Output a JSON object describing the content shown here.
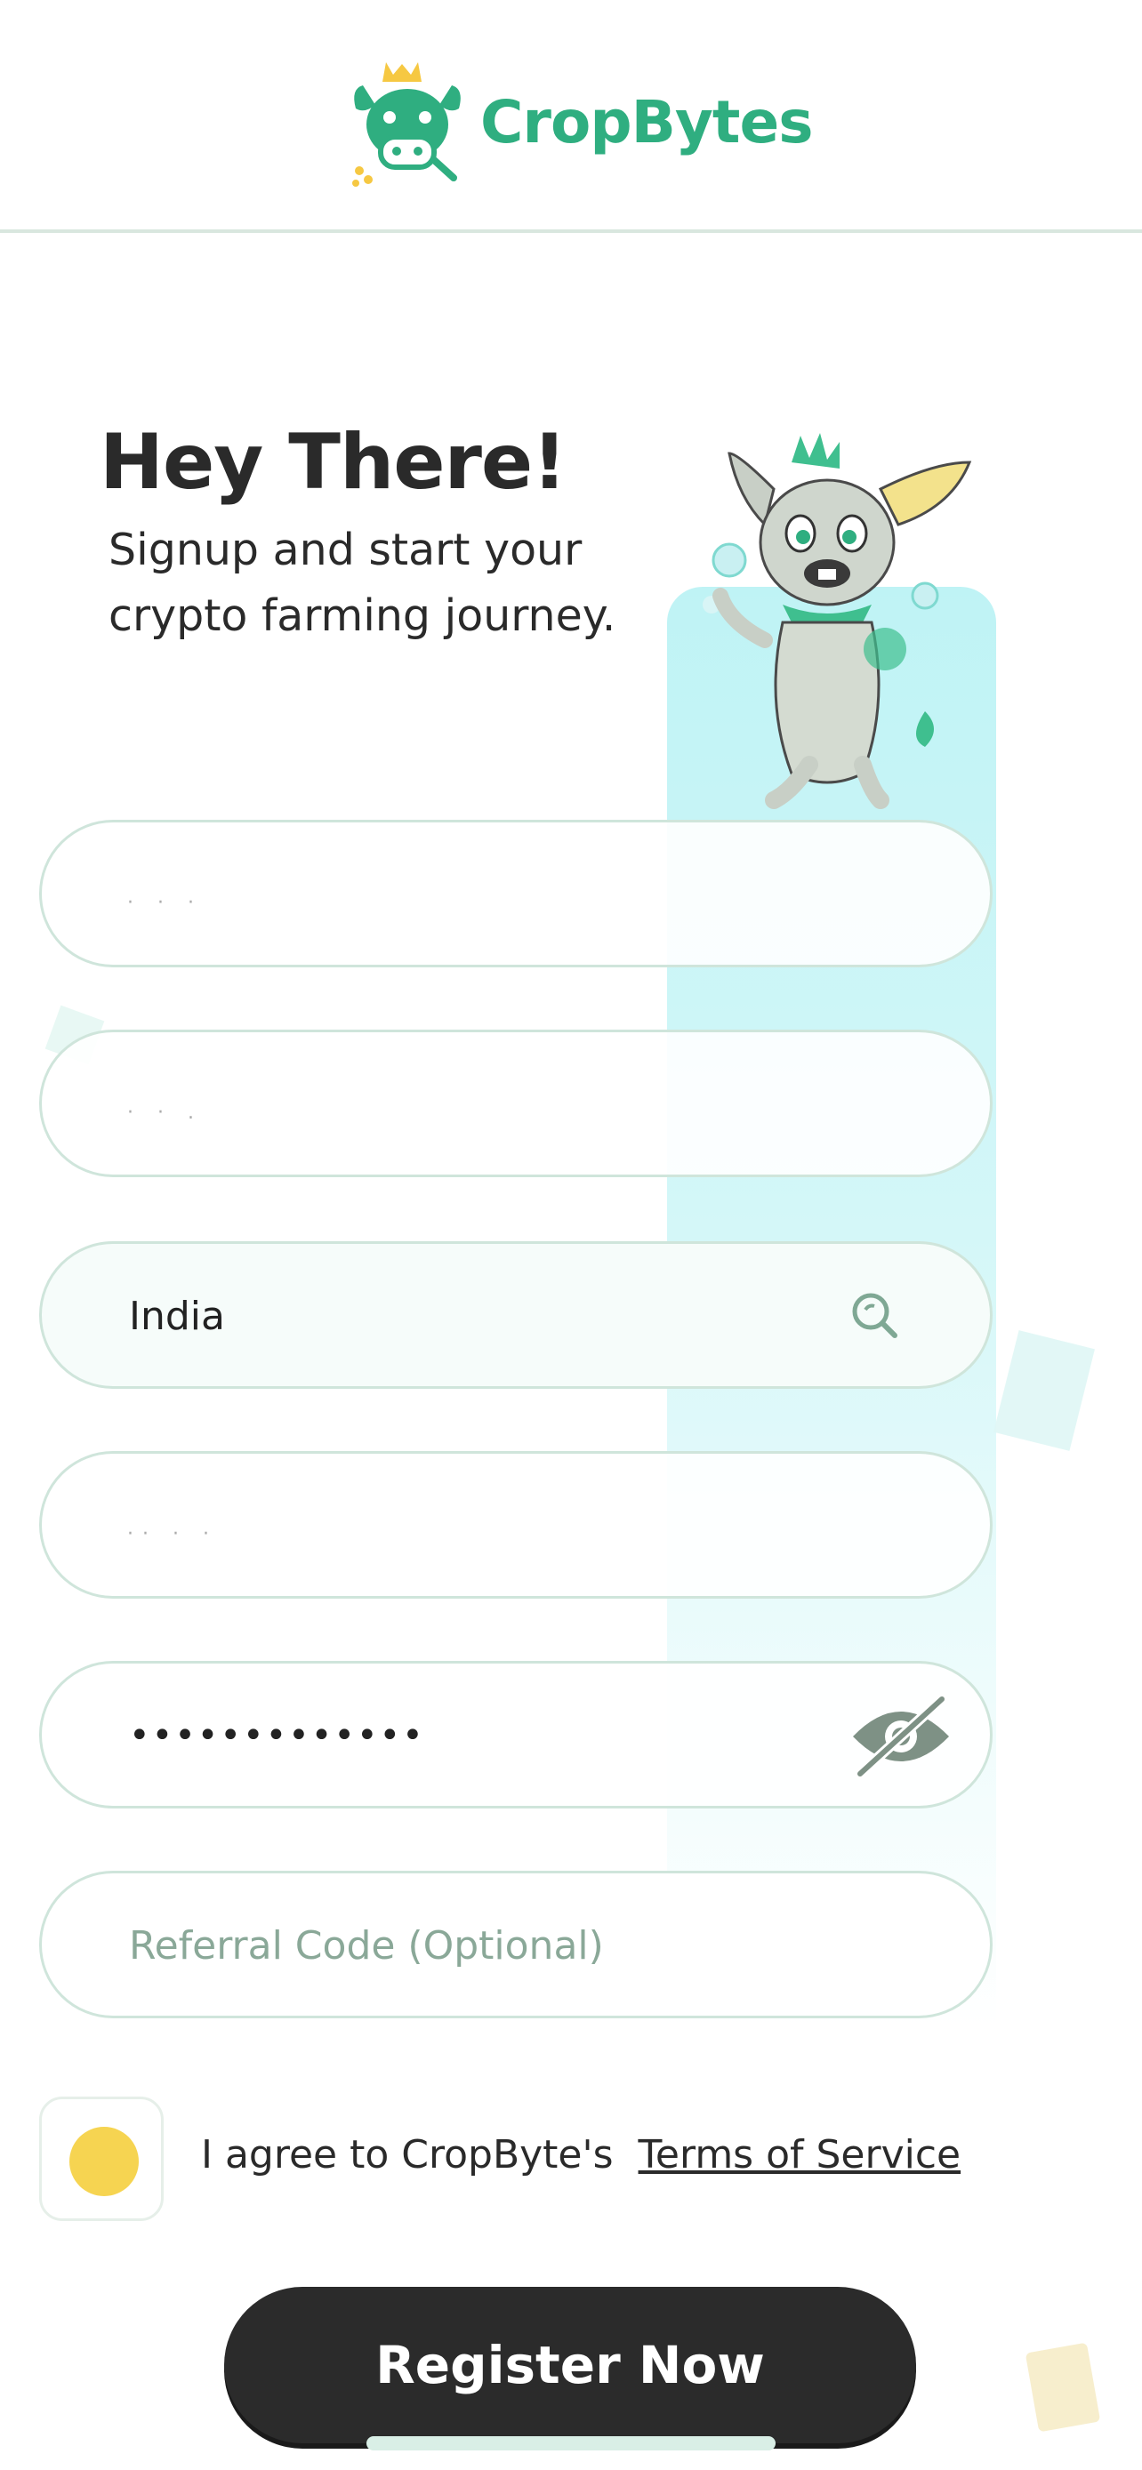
{
  "brand": {
    "name": "CropBytes",
    "color": "#2fae80"
  },
  "intro": {
    "heading": "Hey There!",
    "subheading": "Signup and start your crypto farming journey."
  },
  "form": {
    "country": "India",
    "password_masked": "*************",
    "referral_placeholder": "Referral Code (Optional)",
    "search_icon": "search-icon",
    "visibility_icon": "eye-off-icon"
  },
  "terms": {
    "text": "I agree to CropByte's",
    "link": "Terms of Service"
  },
  "actions": {
    "register_label": "Register Now"
  }
}
